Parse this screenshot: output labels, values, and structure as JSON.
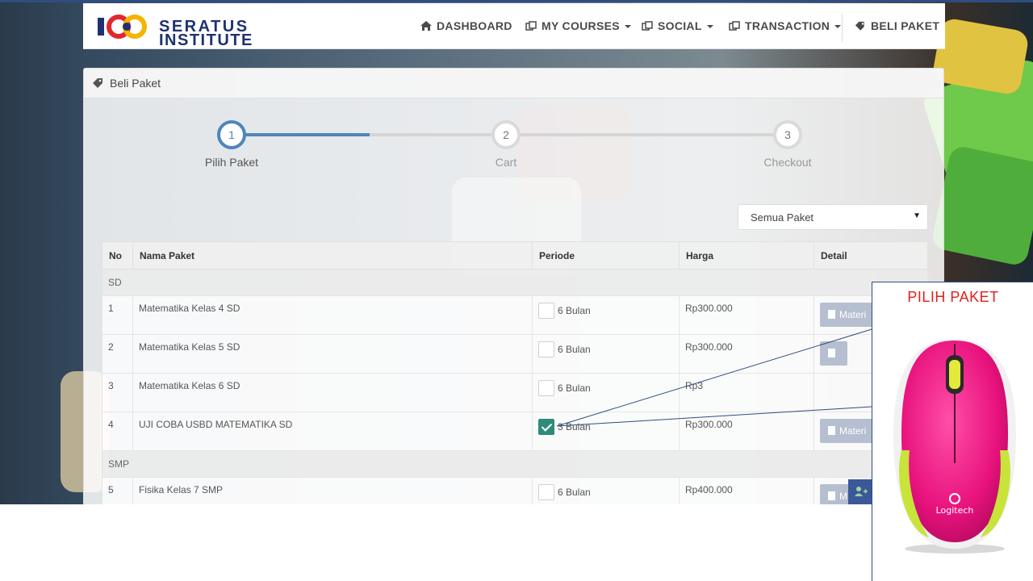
{
  "brand": {
    "line1": "SERATUS",
    "line2": "INSTITUTE"
  },
  "nav": {
    "dashboard": "DASHBOARD",
    "my_courses": "MY COURSES",
    "social": "SOCIAL",
    "transaction": "TRANSACTION",
    "beli_paket": "BELI PAKET"
  },
  "panel": {
    "title": "Beli Paket"
  },
  "steps": [
    {
      "number": "1",
      "label": "Pilih Paket"
    },
    {
      "number": "2",
      "label": "Cart"
    },
    {
      "number": "3",
      "label": "Checkout"
    }
  ],
  "filter": {
    "selected": "Semua Paket"
  },
  "table": {
    "headers": [
      "No",
      "Nama Paket",
      "Periode",
      "Harga",
      "Detail"
    ],
    "groups": [
      {
        "name": "SD",
        "rows": [
          {
            "no": "1",
            "name": "Matematika Kelas 4 SD",
            "periode": "6 Bulan",
            "harga": "Rp300.000",
            "detail": "Materi",
            "checked": false
          },
          {
            "no": "2",
            "name": "Matematika Kelas 5 SD",
            "periode": "6 Bulan",
            "harga": "Rp300.000",
            "detail": "",
            "checked": false
          },
          {
            "no": "3",
            "name": "Matematika Kelas 6 SD",
            "periode": "6 Bulan",
            "harga": "Rp3",
            "detail": "",
            "checked": false
          },
          {
            "no": "4",
            "name": "UJI COBA USBD MATEMATIKA SD",
            "periode": "3 Bulan",
            "harga": "Rp300.000",
            "detail": "Materi",
            "checked": true
          }
        ]
      },
      {
        "name": "SMP",
        "rows": [
          {
            "no": "5",
            "name": "Fisika Kelas 7 SMP",
            "periode": "6 Bulan",
            "harga": "Rp400.000",
            "detail": "M",
            "checked": false
          }
        ]
      }
    ]
  },
  "popup": {
    "title": "PILIH PAKET",
    "mouse_brand": "Logitech"
  },
  "colors": {
    "brand_blue": "#1f3170",
    "step_active": "#4f86b8",
    "check_green": "#2e8b7a",
    "popup_title": "#e0201a"
  }
}
